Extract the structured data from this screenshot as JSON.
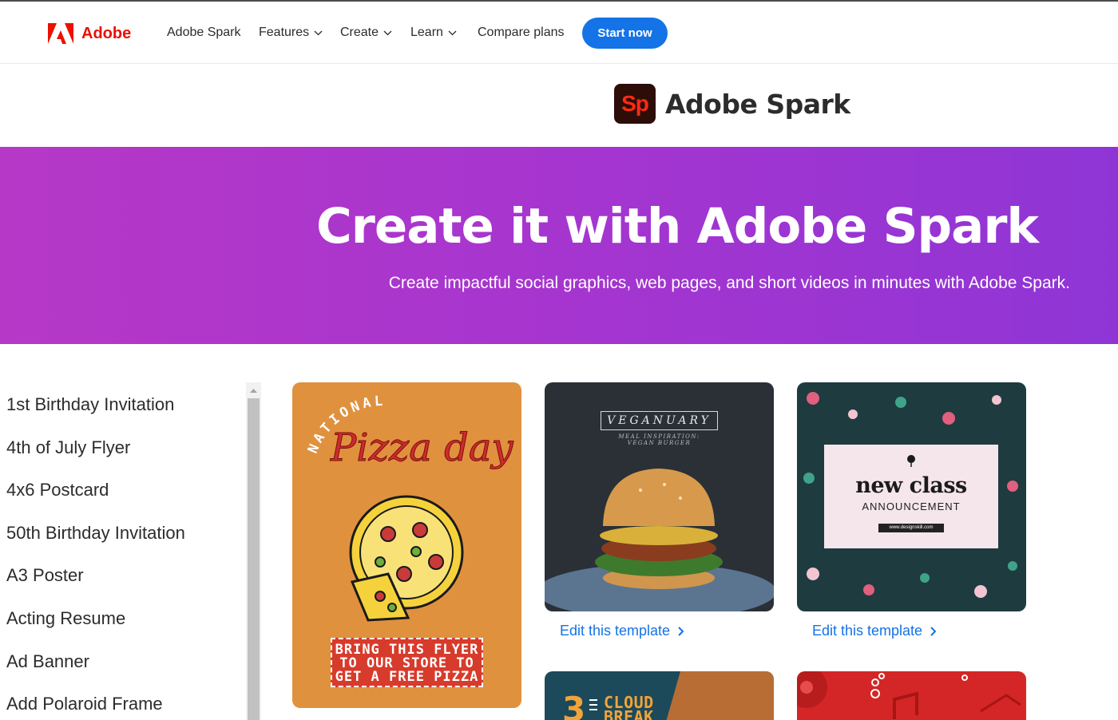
{
  "topnav": {
    "logo_text": "Adobe",
    "items": [
      {
        "label": "Adobe Spark",
        "has_dropdown": false
      },
      {
        "label": "Features",
        "has_dropdown": true
      },
      {
        "label": "Create",
        "has_dropdown": true
      },
      {
        "label": "Learn",
        "has_dropdown": true
      },
      {
        "label": "Compare plans",
        "has_dropdown": false
      }
    ],
    "cta_label": "Start now"
  },
  "brand": {
    "badge": "Sp",
    "name": "Adobe Spark"
  },
  "hero": {
    "title": "Create it with Adobe Spark",
    "subtitle": "Create impactful social graphics, web pages, and short videos in minutes with Adobe Spark."
  },
  "sidebar": {
    "items": [
      "1st Birthday Invitation",
      "4th of July Flyer",
      "4x6 Postcard",
      "50th Birthday Invitation",
      "A3 Poster",
      "Acting Resume",
      "Ad Banner",
      "Add Polaroid Frame"
    ]
  },
  "templates": {
    "pizza": {
      "arc_text": "NATIONAL",
      "script_text": "Pizza day",
      "banner_text": "BRING THIS FLYER\nTO OUR STORE TO\nGET A FREE PIZZA"
    },
    "burger": {
      "title": "VEGANUARY",
      "subtitle": "MEAL INSPIRATION:\nVEGAN BURGER",
      "edit_label": "Edit this template"
    },
    "floral": {
      "title": "new class",
      "subtitle": "ANNOUNCEMENT",
      "url": "www.designskill.com",
      "edit_label": "Edit this template"
    },
    "cloud": {
      "text": "CLOUD\nBREAK"
    }
  },
  "colors": {
    "adobe_red": "#eb1000",
    "cta_blue": "#1473e6",
    "hero_start": "#b638c7",
    "hero_end": "#8f35d6",
    "link_blue": "#1473e6"
  }
}
